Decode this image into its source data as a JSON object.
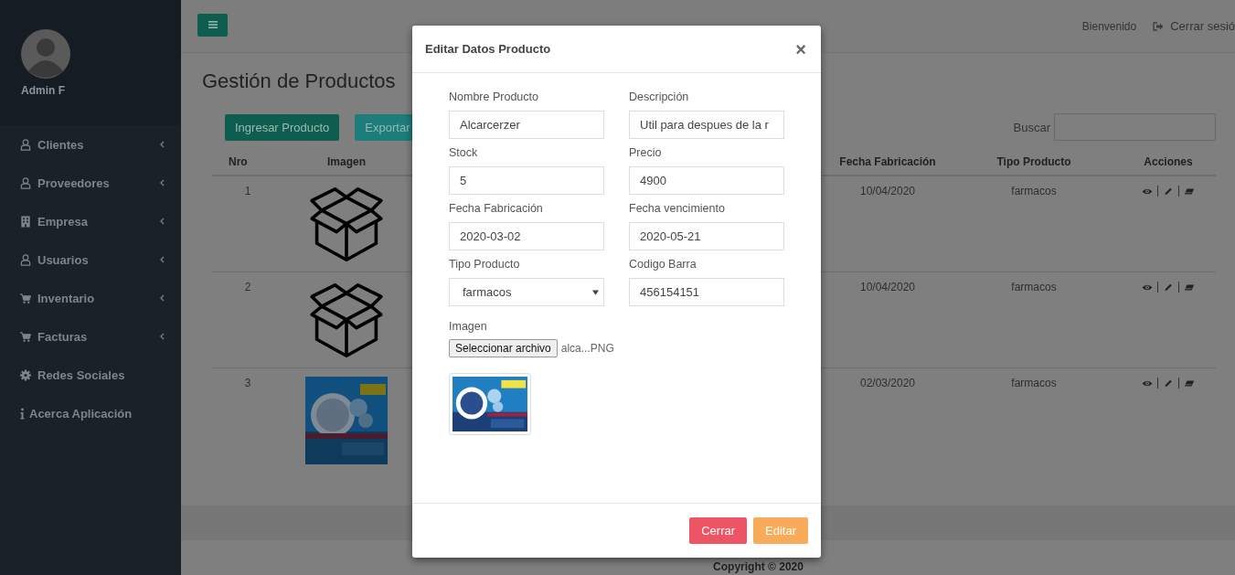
{
  "sidebar": {
    "user": "Admin F",
    "items": [
      {
        "label": "Clientes",
        "kind": "user",
        "has_submenu": true
      },
      {
        "label": "Proveedores",
        "kind": "user",
        "has_submenu": true
      },
      {
        "label": "Empresa",
        "kind": "building",
        "has_submenu": true
      },
      {
        "label": "Usuarios",
        "kind": "user",
        "has_submenu": true
      },
      {
        "label": "Inventario",
        "kind": "cart",
        "has_submenu": true
      },
      {
        "label": "Facturas",
        "kind": "cart",
        "has_submenu": true
      },
      {
        "label": "Redes Sociales",
        "kind": "gear",
        "has_submenu": false
      },
      {
        "label": "Acerca Aplicación",
        "kind": "info",
        "has_submenu": false
      }
    ]
  },
  "topbar": {
    "welcome": "Bienvenido",
    "logout": "Cerrar sesió"
  },
  "page": {
    "title": "Gestión de Productos",
    "buttons": [
      {
        "label": "Ingresar Producto",
        "kind": "primary"
      },
      {
        "label": "Exportar",
        "kind": "info"
      }
    ],
    "search_label": "Buscar"
  },
  "table": {
    "columns": [
      "Nro",
      "Imagen",
      "Fecha Fabricación",
      "Tipo Producto",
      "Acciones"
    ],
    "rows": [
      {
        "nro": "1",
        "kind": "box",
        "fecha": "10/04/2020",
        "tipo": "farmacos"
      },
      {
        "nro": "2",
        "kind": "box",
        "fecha": "10/04/2020",
        "tipo": "farmacos"
      },
      {
        "nro": "3",
        "kind": "picture",
        "fecha": "02/03/2020",
        "tipo": "farmacos"
      }
    ]
  },
  "footer": "Copyright © 2020",
  "modal": {
    "title": "Editar Datos Producto",
    "close": "×",
    "fields": [
      {
        "label": "Nombre Producto",
        "value": "Alcarcerzer",
        "kind": "text"
      },
      {
        "label": "Descripción",
        "value": "Util para despues de la r",
        "kind": "text"
      },
      {
        "label": "Stock",
        "value": "5",
        "kind": "text"
      },
      {
        "label": "Precio",
        "value": "4900",
        "kind": "text"
      },
      {
        "label": "Fecha Fabricación",
        "value": "2020-03-02",
        "kind": "text"
      },
      {
        "label": "Fecha vencimiento",
        "value": "2020-05-21",
        "kind": "text"
      },
      {
        "label": "Tipo Producto",
        "value": "farmacos",
        "kind": "select"
      },
      {
        "label": "Codigo Barra",
        "value": "456154151",
        "kind": "text"
      }
    ],
    "image_label": "Imagen",
    "file_button": "Seleccionar archivo",
    "file_name": "alca...PNG",
    "buttons": [
      {
        "label": "Cerrar",
        "kind": "danger"
      },
      {
        "label": "Editar",
        "kind": "warning"
      }
    ]
  }
}
